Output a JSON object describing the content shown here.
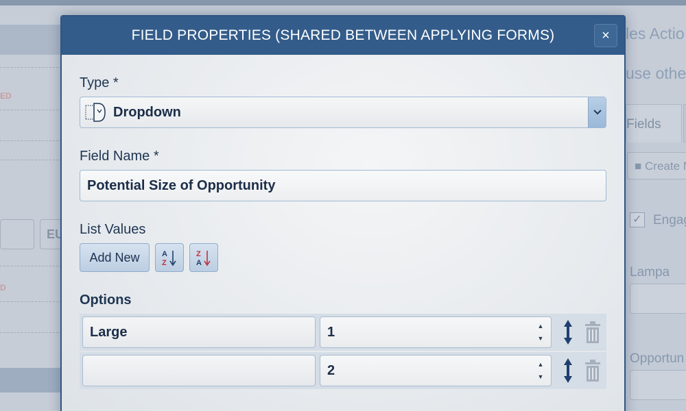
{
  "background": {
    "left_texts": [
      "ED",
      "EU",
      "D"
    ],
    "right_texts": [
      "les Actio",
      "use othe"
    ],
    "tab_label": "Fields",
    "create_label": "Create N",
    "checkbox_label": "Engag",
    "field_labels": [
      "Lampa",
      "Opportun"
    ]
  },
  "modal": {
    "title": "FIELD PROPERTIES (SHARED BETWEEN APPLYING FORMS)",
    "close_glyph": "×",
    "type": {
      "label": "Type *",
      "value": "Dropdown",
      "icon": "dropdown-type-icon"
    },
    "field_name": {
      "label": "Field Name *",
      "value": "Potential Size of Opportunity"
    },
    "list_values": {
      "label": "List Values",
      "add_new_label": "Add New",
      "sort_az_icon": "sort-a-z-icon",
      "sort_za_icon": "sort-z-a-icon"
    },
    "options": {
      "label": "Options",
      "rows": [
        {
          "text": "Large",
          "number": "1"
        },
        {
          "text": "",
          "number": "2"
        }
      ]
    }
  },
  "colors": {
    "header": "#335c8a",
    "accent_red": "#c0303a",
    "icon_blue": "#1f3f6e"
  }
}
